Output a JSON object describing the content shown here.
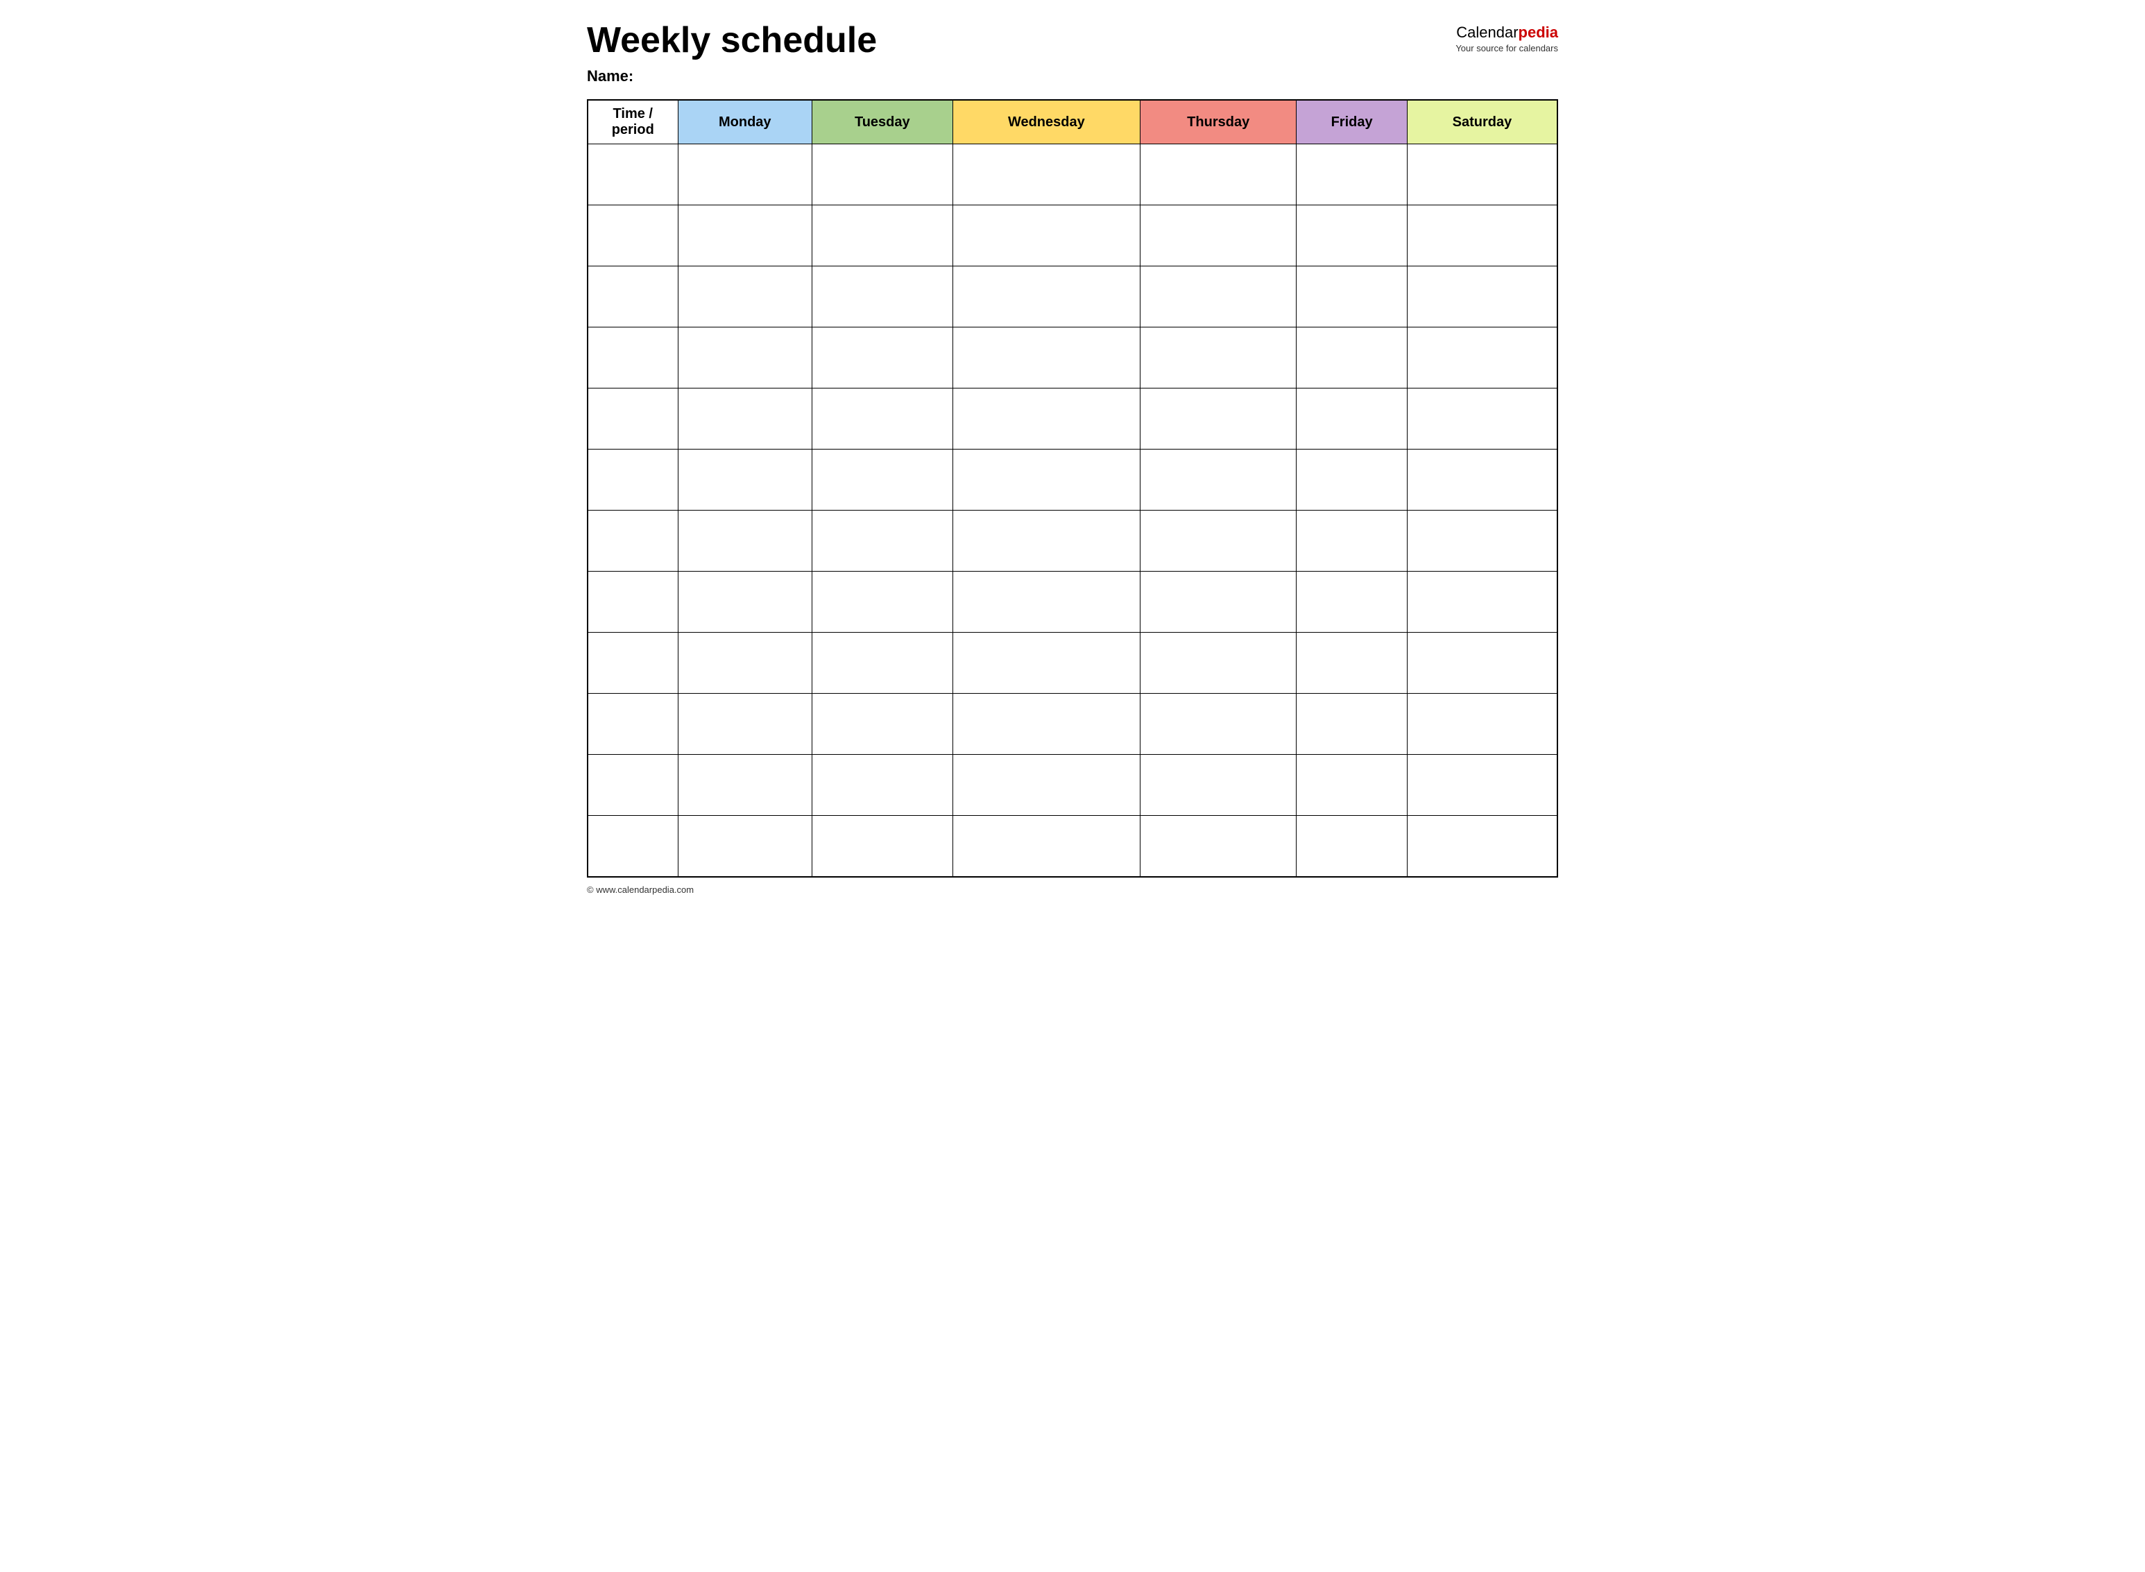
{
  "page": {
    "title": "Weekly schedule",
    "name_label": "Name:",
    "footer_url": "www.calendarpedia.com",
    "footer_text": "© www.calendarpedia.com"
  },
  "logo": {
    "calendar_text": "Calendar",
    "pedia_text": "pedia",
    "tagline": "Your source for calendars"
  },
  "table": {
    "headers": {
      "time_period": "Time / period",
      "monday": "Monday",
      "tuesday": "Tuesday",
      "wednesday": "Wednesday",
      "thursday": "Thursday",
      "friday": "Friday",
      "saturday": "Saturday"
    },
    "rows": 12
  }
}
